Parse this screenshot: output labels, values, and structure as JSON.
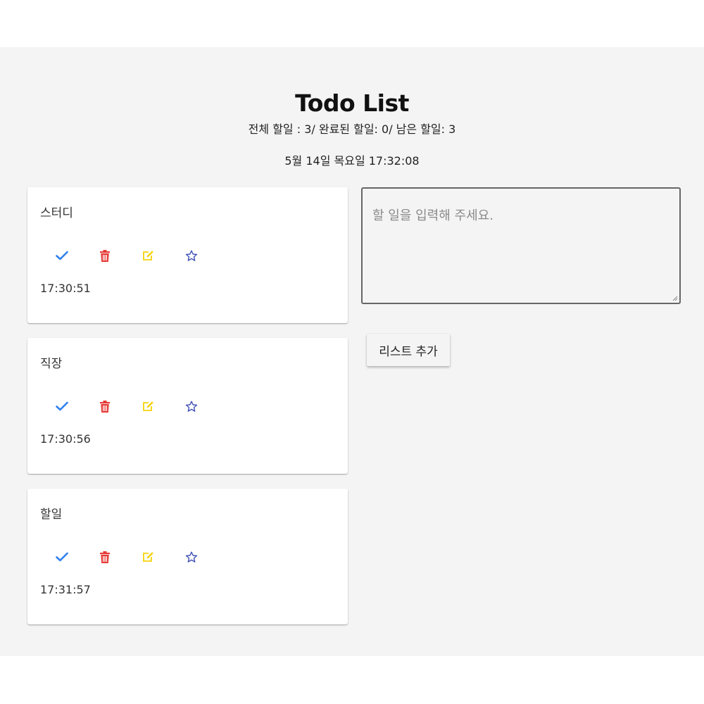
{
  "header": {
    "title": "Todo List",
    "stats": "전체 할일 : 3/ 완료된 할일: 0/ 남은 할일: 3",
    "clock": "5월 14일 목요일 17:32:08"
  },
  "todos": [
    {
      "text": "스터디",
      "time": "17:30:51"
    },
    {
      "text": "직장",
      "time": "17:30:56"
    },
    {
      "text": "할일",
      "time": "17:31:57"
    }
  ],
  "icons": {
    "check": "check-icon",
    "delete": "trash-icon",
    "edit": "edit-icon",
    "star": "star-outline-icon"
  },
  "colors": {
    "check": "#2f80ed",
    "delete": "#e53935",
    "edit": "#f5d30a",
    "star": "#3f51b5",
    "background": "#f4f4f4"
  },
  "form": {
    "placeholder": "할 일을 입력해 주세요.",
    "value": "",
    "add_label": "리스트 추가"
  }
}
